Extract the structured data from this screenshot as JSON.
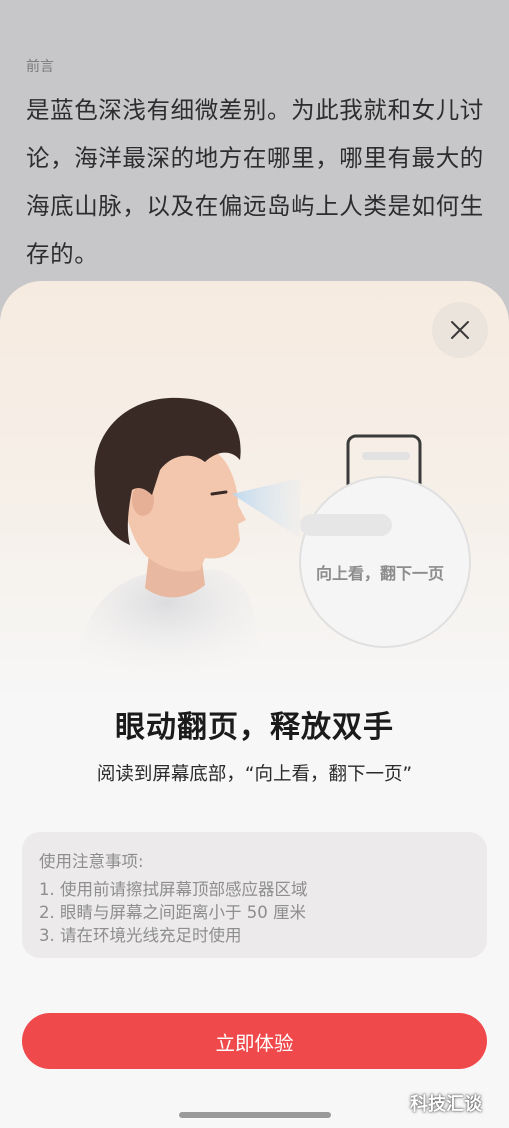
{
  "reader": {
    "section_label": "前言",
    "paragraph": "是蓝色深浅有细微差别。为此我就和女儿讨论，海洋最深的地方在哪里，哪里有最大的海底山脉，以及在偏远岛屿上人类是如何生存的。"
  },
  "sheet": {
    "close_icon": "close-icon",
    "illustration_caption": "向上看，翻下一页",
    "title": "眼动翻页，释放双手",
    "subtitle": "阅读到屏幕底部，“向上看，翻下一页”",
    "notes": {
      "title": "使用注意事项:",
      "items": [
        "1. 使用前请擦拭屏幕顶部感应器区域",
        "2. 眼睛与屏幕之间距离小于 50 厘米",
        "3. 请在环境光线充足时使用"
      ]
    },
    "cta_label": "立即体验"
  },
  "watermark": "科技汇谈",
  "colors": {
    "accent": "#f0494b",
    "sheet_top": "#f6ebe0",
    "overlay": "#c7c7c9"
  }
}
